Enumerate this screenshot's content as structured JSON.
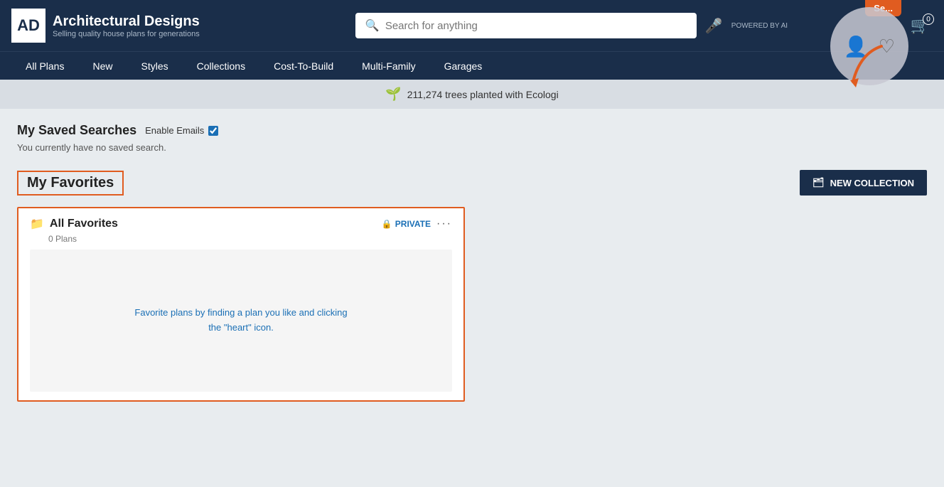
{
  "brand": {
    "logo_text": "AD",
    "title": "Architectural Designs",
    "subtitle": "Selling quality house plans for generations"
  },
  "header": {
    "search_placeholder": "Search for anything",
    "powered_by": "POWERED BY AI",
    "orange_tab_label": "Se..."
  },
  "nav": {
    "items": [
      {
        "label": "All Plans",
        "id": "all-plans"
      },
      {
        "label": "New",
        "id": "new"
      },
      {
        "label": "Styles",
        "id": "styles"
      },
      {
        "label": "Collections",
        "id": "collections"
      },
      {
        "label": "Cost-To-Build",
        "id": "cost-to-build"
      },
      {
        "label": "Multi-Family",
        "id": "multi-family"
      },
      {
        "label": "Garages",
        "id": "garages"
      }
    ]
  },
  "eco_banner": {
    "text": "211,274 trees planted with Ecologi"
  },
  "saved_searches": {
    "title": "My Saved Searches",
    "enable_emails_label": "Enable Emails",
    "no_saved_text": "You currently have no saved search."
  },
  "favorites": {
    "title": "My Favorites",
    "new_collection_label": "NEW COLLECTION",
    "collection": {
      "name": "All Favorites",
      "plans_count": "0 Plans",
      "privacy": "PRIVATE",
      "empty_hint": "Favorite plans by finding a plan you like and clicking the \"heart\" icon."
    }
  },
  "cart_count": "0"
}
